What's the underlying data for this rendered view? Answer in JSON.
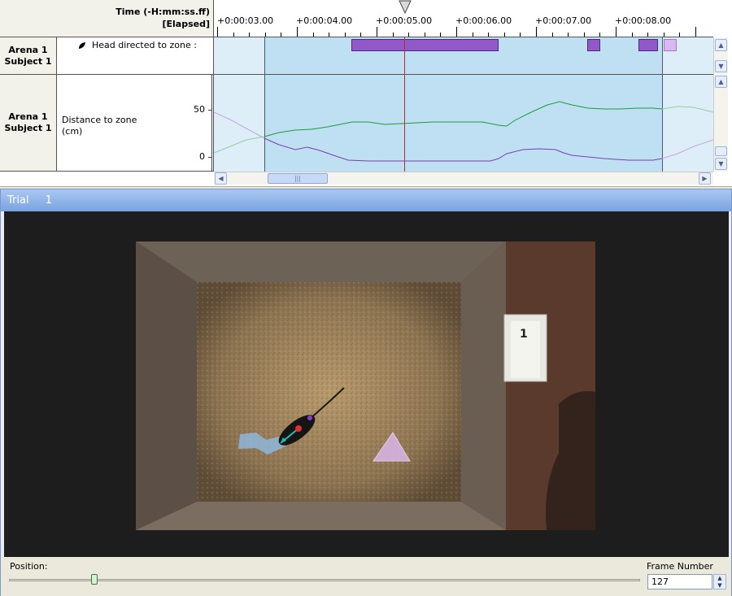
{
  "timeline": {
    "time_header_line1": "Time (-H:mm:ss.ff)",
    "time_header_line2": "[Elapsed]",
    "ticks": [
      "+0:00:03.00",
      "+0:00:04.00",
      "+0:00:05.00",
      "+0:00:06.00",
      "+0:00:07.00",
      "+0:00:08.00"
    ],
    "rows": [
      {
        "arena": "Arena 1",
        "subject": "Subject 1",
        "variable": "Head directed to zone :"
      },
      {
        "arena": "Arena 1",
        "subject": "Subject 1",
        "variable": "Distance to zone",
        "unit": "(cm)",
        "axis_labels": [
          "50",
          "0"
        ]
      }
    ],
    "colors": {
      "bar": "#9158c8",
      "bar_inactive": "#d8b8ef",
      "line_green": "#1f9a3a",
      "line_purple": "#7a3fb0",
      "cursor": "#c0282c",
      "selection": "#bfe0f2"
    },
    "icons": {
      "variable": "leaf-icon",
      "cursor": "playhead-triangle-icon"
    }
  },
  "trial": {
    "title": "Trial",
    "number": "1",
    "arena_sign": "1",
    "position_label": "Position:",
    "position_fraction": 0.135,
    "frame_number_label": "Frame Number",
    "frame_number": "127"
  }
}
